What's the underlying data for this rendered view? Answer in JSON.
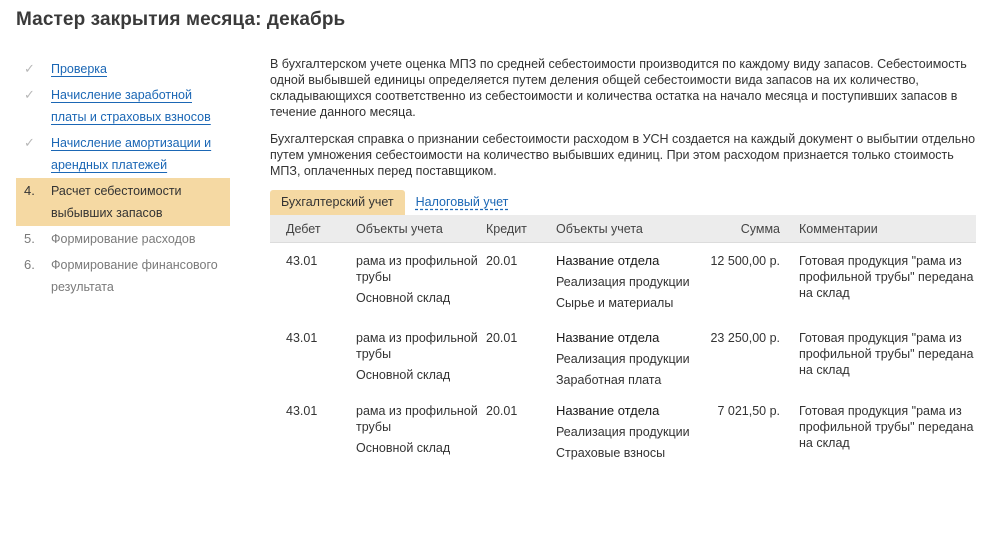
{
  "page": {
    "title": "Мастер закрытия месяца: декабрь"
  },
  "steps": [
    {
      "marker": "✓",
      "label": "Проверка",
      "state": "done"
    },
    {
      "marker": "✓",
      "label": "Начисление заработной платы и страховых взносов",
      "state": "done"
    },
    {
      "marker": "✓",
      "label": "Начисление амортизации и арендных платежей",
      "state": "done"
    },
    {
      "marker": "4.",
      "label": "Расчет себестоимости выбывших запасов",
      "state": "active"
    },
    {
      "marker": "5.",
      "label": "Формирование расходов",
      "state": "pending"
    },
    {
      "marker": "6.",
      "label": "Формирование финансового результата",
      "state": "pending"
    }
  ],
  "intro": {
    "p1": "В бухгалтерском учете оценка МПЗ по средней себестоимости производится по каждому виду запасов. Себестоимость одной выбывшей единицы определяется путем деления общей себестоимости вида запасов на их количество, складывающихся соответственно из себестоимости и количества остатка на начало месяца и поступивших запасов в течение данного месяца.",
    "p2": "Бухгалтерская справка о признании себестоимости расходом в УСН создается на каждый документ о выбытии отдельно путем умножения себестоимости на количество выбывших единиц. При этом расходом признается только стоимость МПЗ, оплаченных перед поставщиком."
  },
  "tabs": [
    {
      "label": "Бухгалтерский учет",
      "active": true
    },
    {
      "label": "Налоговый учет",
      "active": false
    }
  ],
  "table": {
    "headers": {
      "debit": "Дебет",
      "obj1": "Объекты учета",
      "credit": "Кредит",
      "obj2": "Объекты учета",
      "sum": "Сумма",
      "comment": "Комментарии"
    },
    "rows": [
      {
        "debit": "43.01",
        "obj1_a": "рама из профильной трубы",
        "obj1_b": "Основной склад",
        "credit": "20.01",
        "dept": "Название отдела",
        "obj2_a": "Реализация продукции",
        "obj2_b": "Сырье и материалы",
        "sum": "12 500,00 р.",
        "comment": "Готовая продукция \"рама из профильной трубы\" передана на склад"
      },
      {
        "debit": "43.01",
        "obj1_a": "рама из профильной трубы",
        "obj1_b": "Основной склад",
        "credit": "20.01",
        "dept": "Название отдела",
        "obj2_a": "Реализация продукции",
        "obj2_b": "Заработная плата",
        "sum": "23 250,00 р.",
        "comment": "Готовая продукция \"рама из профильной трубы\" передана на склад"
      },
      {
        "debit": "43.01",
        "obj1_a": "рама из профильной трубы",
        "obj1_b": "Основной склад",
        "credit": "20.01",
        "dept": "Название отдела",
        "obj2_a": "Реализация продукции",
        "obj2_b": "Страховые взносы",
        "sum": "7 021,50 р.",
        "comment": "Готовая продукция \"рама из профильной трубы\" передана на склад"
      }
    ]
  }
}
